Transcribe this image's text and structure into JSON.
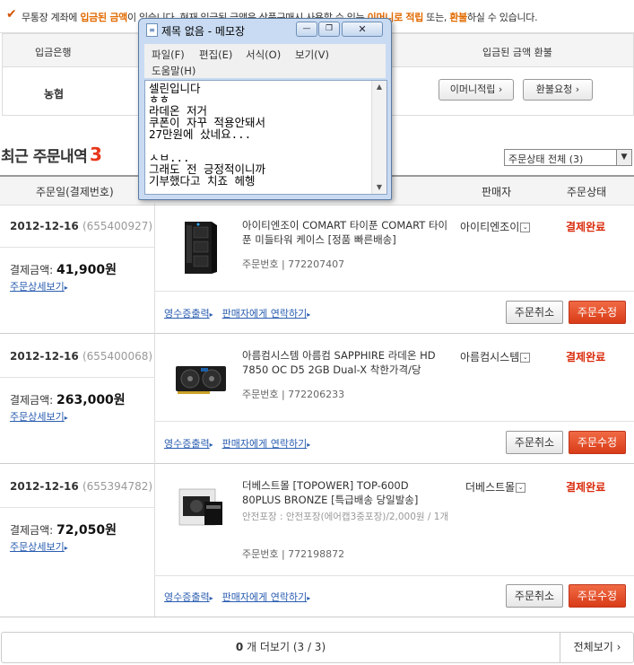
{
  "notice": {
    "prefix": "무통장 계좌에 ",
    "highlight1": "입금된 금액",
    "middle": "이 있습니다. 현재 입금된 금액은 상품구매시 사용할 수 있는 ",
    "highlight2": "이머니로 적립",
    "middle2": " 또는, ",
    "highlight3": "환불",
    "suffix": "하실 수 있습니다."
  },
  "deposit": {
    "col_bank": "입금은행",
    "col_refund": "입금된 금액 환불",
    "bank": "농협",
    "emoney_button": "이머니적립 ›",
    "refund_button": "환불요청 ›"
  },
  "recent": {
    "title": "최근 주문내역",
    "count": "3",
    "status_select": "주문상태 전체 (3)"
  },
  "order_header": {
    "date": "주문일(결제번호)",
    "seller": "판매자",
    "status": "주문상태"
  },
  "orders": [
    {
      "date": "2012-12-16",
      "payno": "(655400927)",
      "pay_label": "결제금액: ",
      "pay_amount": "41,900",
      "won": "원",
      "detail_link": "주문상세보기",
      "product": "아이티엔조이 COMART 타이푼 COMART 타이푼 미들타워 케이스 [정품 빠른배송]",
      "extra": "",
      "order_no_label": "주문번호 | 772207407",
      "seller": "아이티엔조이",
      "status": "결제완료",
      "receipt_link": "영수증출력",
      "contact_link": "판매자에게 연락하기",
      "cancel": "주문취소",
      "modify": "주문수정"
    },
    {
      "date": "2012-12-16",
      "payno": "(655400068)",
      "pay_label": "결제금액: ",
      "pay_amount": "263,000",
      "won": "원",
      "detail_link": "주문상세보기",
      "product": "아름컴시스템 아름컴 SAPPHIRE 라데온 HD 7850 OC D5 2GB Dual-X 착한가격/당",
      "extra": "",
      "order_no_label": "주문번호 | 772206233",
      "seller": "아름컴시스템",
      "status": "결제완료",
      "receipt_link": "영수증출력",
      "contact_link": "판매자에게 연락하기",
      "cancel": "주문취소",
      "modify": "주문수정"
    },
    {
      "date": "2012-12-16",
      "payno": "(655394782)",
      "pay_label": "결제금액: ",
      "pay_amount": "72,050",
      "won": "원",
      "detail_link": "주문상세보기",
      "product": "더베스트몰 [TOPOWER] TOP-600D 80PLUS BRONZE [특급배송 당일발송]",
      "extra": "안전포장 : 안전포장(에어캡3중포장)/2,000원 / 1개",
      "order_no_label": "주문번호 | 772198872",
      "seller": "더베스트몰",
      "status": "결제완료",
      "receipt_link": "영수증출력",
      "contact_link": "판매자에게 연락하기",
      "cancel": "주문취소",
      "modify": "주문수정"
    }
  ],
  "more": {
    "count": "0",
    "text": "개 더보기 (3 / 3)",
    "all": "전체보기 ›"
  },
  "notepad": {
    "title": "제목 없음 - 메모장",
    "menus": [
      "파일(F)",
      "편집(E)",
      "서식(O)",
      "보기(V)",
      "도움말(H)"
    ],
    "lines": [
      "셀린입니다",
      "ㅎㅎ",
      "라데온 저거",
      "쿠폰이 자꾸 적용안돼서",
      "27만원에 샀네요...",
      "",
      "ㅅㅂ...",
      "그래도 전 긍정적이니까",
      "기부했다고 치죠 헤헹"
    ]
  },
  "colors": {
    "accent_orange": "#e26a00",
    "status_red": "#d92b0b",
    "modify_button": "#e24b26",
    "link_blue": "#2a5db0"
  }
}
